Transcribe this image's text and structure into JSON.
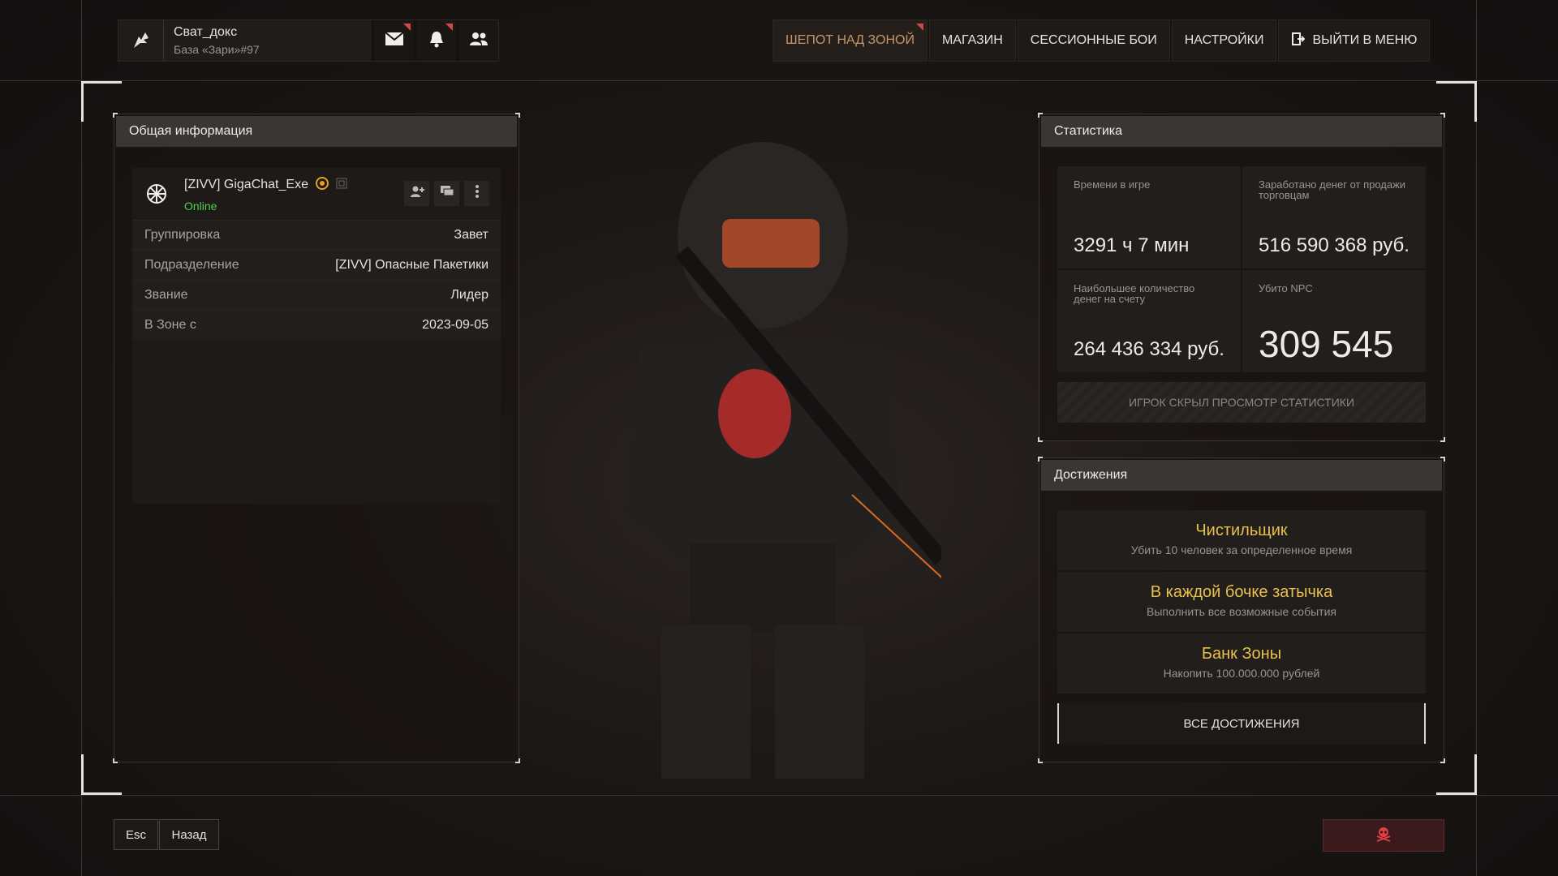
{
  "profile": {
    "name": "Сват_докс",
    "base": "База «Зари»#97"
  },
  "header_icons": [
    "mail-icon",
    "bell-icon",
    "friends-icon"
  ],
  "nav": {
    "items": [
      {
        "label": "ШЕПОТ НАД ЗОНОЙ",
        "active": true
      },
      {
        "label": "МАГАЗИН"
      },
      {
        "label": "СЕССИОННЫЕ БОИ"
      },
      {
        "label": "НАСТРОЙКИ"
      },
      {
        "label": "ВЫЙТИ В МЕНЮ",
        "icon": "exit-icon"
      }
    ]
  },
  "general": {
    "title": "Общая информация",
    "player": {
      "name": "[ZIVV] GigaChat_Exe",
      "status": "Online"
    },
    "rows": [
      {
        "key": "Группировка",
        "value": "Завет"
      },
      {
        "key": "Подразделение",
        "value": "[ZIVV] Опасные Пакетики"
      },
      {
        "key": "Звание",
        "value": "Лидер"
      },
      {
        "key": "В Зоне с",
        "value": "2023-09-05"
      }
    ]
  },
  "stats": {
    "title": "Статистика",
    "cells": [
      {
        "label": "Времени в игре",
        "value": "3291 ч 7 мин"
      },
      {
        "label": "Заработано денег от продажи торговцам",
        "value": "516 590 368 руб."
      },
      {
        "label": "Наибольшее количество денег на счету",
        "value": "264 436 334 руб."
      },
      {
        "label": "Убито NPC",
        "value": "309 545"
      }
    ],
    "hidden_note": "ИГРОК СКРЫЛ ПРОСМОТР СТАТИСТИКИ"
  },
  "achievements": {
    "title": "Достижения",
    "items": [
      {
        "title": "Чистильщик",
        "desc": "Убить 10 человек за определенное время"
      },
      {
        "title": "В каждой бочке затычка",
        "desc": "Выполнить все возможные события"
      },
      {
        "title": "Банк Зоны",
        "desc": "Накопить 100.000.000 рублей"
      }
    ],
    "all_label": "ВСЕ ДОСТИЖЕНИЯ"
  },
  "bottom": {
    "esc_label": "Esc",
    "back_label": "Назад",
    "report_icon": "skull-icon"
  },
  "colors": {
    "accent": "#c6956a",
    "online": "#4fcf4f",
    "achievement": "#e8c04a",
    "danger": "#d14848"
  }
}
